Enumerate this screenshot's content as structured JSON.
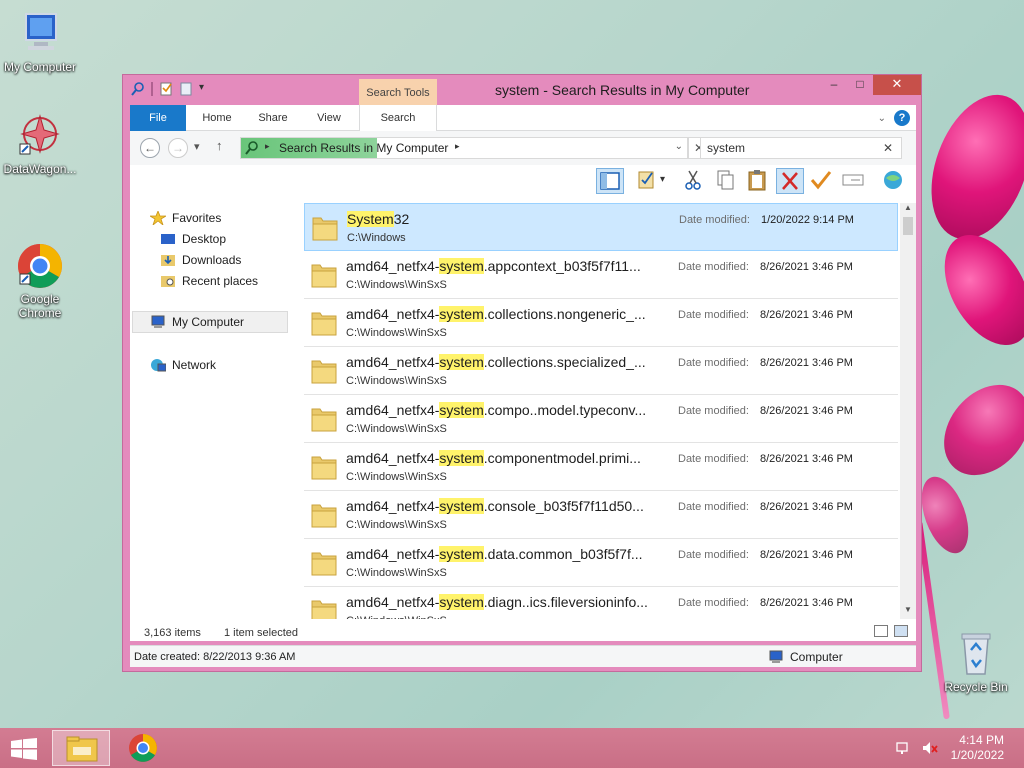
{
  "desktop": {
    "icons": [
      {
        "label": "My Computer"
      },
      {
        "label": "DataWagon..."
      },
      {
        "label": "Google\nChrome"
      },
      {
        "label": "Recycle Bin"
      }
    ]
  },
  "window": {
    "title": "system - Search Results in My Computer",
    "context_tab_group": "Search Tools",
    "caption": {
      "minimize": "–",
      "maximize": "□",
      "close": "✕"
    },
    "ribbon_tabs": [
      "File",
      "Home",
      "Share",
      "View",
      "Search"
    ],
    "help": "?",
    "address": {
      "crumb": "Search Results in My Computer"
    },
    "search": {
      "value": "system",
      "clear": "✕"
    },
    "sidebar": {
      "favorites": "Favorites",
      "favorites_items": [
        "Desktop",
        "Downloads",
        "Recent places"
      ],
      "my_computer": "My Computer",
      "network": "Network"
    },
    "date_modified_label": "Date modified:",
    "results": [
      {
        "name_pre": "",
        "name_hl": "System",
        "name_post": "32",
        "path": "C:\\Windows",
        "modified": "1/20/2022 9:14 PM",
        "selected": true
      },
      {
        "name_pre": "amd64_netfx4-",
        "name_hl": "system",
        "name_post": ".appcontext_b03f5f7f11...",
        "path": "C:\\Windows\\WinSxS",
        "modified": "8/26/2021 3:46 PM"
      },
      {
        "name_pre": "amd64_netfx4-",
        "name_hl": "system",
        "name_post": ".collections.nongeneric_...",
        "path": "C:\\Windows\\WinSxS",
        "modified": "8/26/2021 3:46 PM"
      },
      {
        "name_pre": "amd64_netfx4-",
        "name_hl": "system",
        "name_post": ".collections.specialized_...",
        "path": "C:\\Windows\\WinSxS",
        "modified": "8/26/2021 3:46 PM"
      },
      {
        "name_pre": "amd64_netfx4-",
        "name_hl": "system",
        "name_post": ".compo..model.typeconv...",
        "path": "C:\\Windows\\WinSxS",
        "modified": "8/26/2021 3:46 PM"
      },
      {
        "name_pre": "amd64_netfx4-",
        "name_hl": "system",
        "name_post": ".componentmodel.primi...",
        "path": "C:\\Windows\\WinSxS",
        "modified": "8/26/2021 3:46 PM"
      },
      {
        "name_pre": "amd64_netfx4-",
        "name_hl": "system",
        "name_post": ".console_b03f5f7f11d50...",
        "path": "C:\\Windows\\WinSxS",
        "modified": "8/26/2021 3:46 PM"
      },
      {
        "name_pre": "amd64_netfx4-",
        "name_hl": "system",
        "name_post": ".data.common_b03f5f7f...",
        "path": "C:\\Windows\\WinSxS",
        "modified": "8/26/2021 3:46 PM"
      },
      {
        "name_pre": "amd64_netfx4-",
        "name_hl": "system",
        "name_post": ".diagn..ics.fileversioninfo...",
        "path": "C:\\Windows\\WinSxS",
        "modified": "8/26/2021 3:46 PM"
      }
    ],
    "status": {
      "item_count": "3,163 items",
      "selection": "1 item selected"
    },
    "details": {
      "date_created": "Date created: 8/22/2013 9:36 AM",
      "location": "Computer"
    }
  },
  "taskbar": {
    "time": "4:14 PM",
    "date": "1/20/2022"
  },
  "colors": {
    "accent": "#1979ca",
    "window_frame": "#e48bbd",
    "highlight": "#fff36b",
    "selection": "#cde8ff"
  }
}
